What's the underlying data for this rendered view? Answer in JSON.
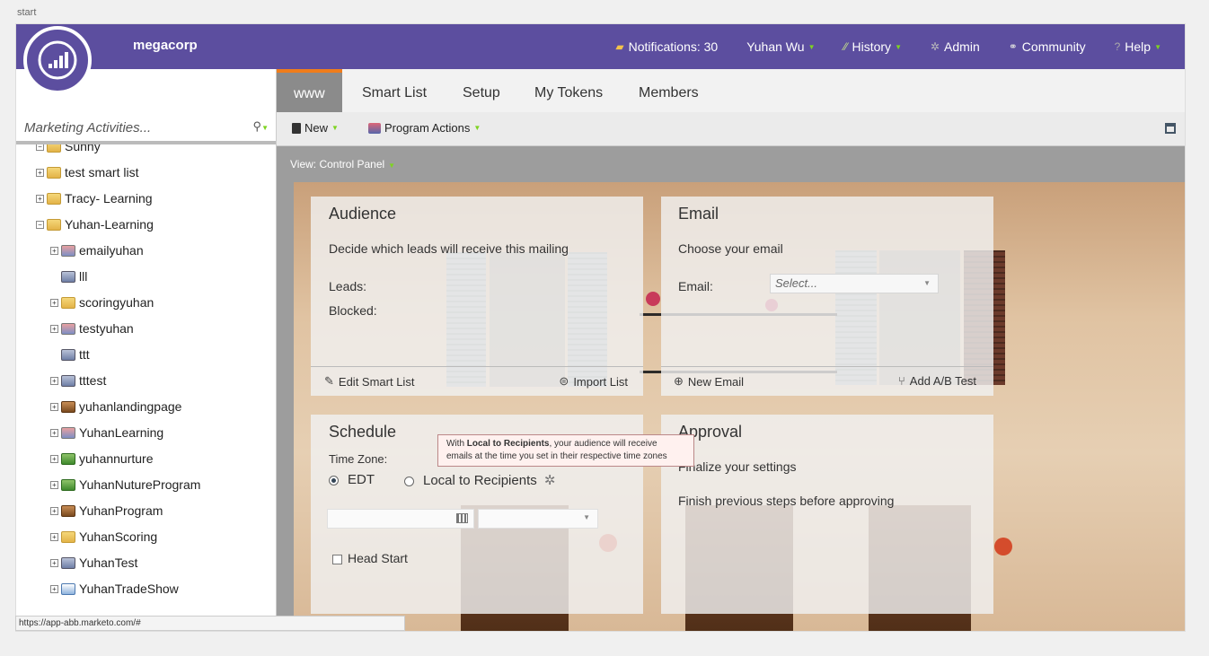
{
  "start_label": "start",
  "brand": "megacorp",
  "topnav": {
    "notifications": "Notifications: 30",
    "user": "Yuhan Wu",
    "history": "History",
    "admin": "Admin",
    "community": "Community",
    "help": "Help"
  },
  "sidebar": {
    "search_placeholder": "Marketing Activities...",
    "items": [
      {
        "label": "Sunny",
        "icon": "folder"
      },
      {
        "label": "test smart list",
        "icon": "folder"
      },
      {
        "label": "Tracy- Learning",
        "icon": "folder"
      },
      {
        "label": "Yuhan-Learning",
        "icon": "folder"
      },
      {
        "label": "emailyuhan",
        "icon": "program"
      },
      {
        "label": "lll",
        "icon": "email-program"
      },
      {
        "label": "scoringyuhan",
        "icon": "folder"
      },
      {
        "label": "testyuhan",
        "icon": "program"
      },
      {
        "label": "ttt",
        "icon": "email-program"
      },
      {
        "label": "tttest",
        "icon": "email-program"
      },
      {
        "label": "yuhanlandingpage",
        "icon": "landing"
      },
      {
        "label": "YuhanLearning",
        "icon": "program"
      },
      {
        "label": "yuhannurture",
        "icon": "nurture"
      },
      {
        "label": "YuhanNutureProgram",
        "icon": "nurture"
      },
      {
        "label": "YuhanProgram",
        "icon": "landing"
      },
      {
        "label": "YuhanScoring",
        "icon": "folder"
      },
      {
        "label": "YuhanTest",
        "icon": "email-program"
      },
      {
        "label": "YuhanTradeShow",
        "icon": "event"
      }
    ]
  },
  "status_url": "https://app-abb.marketo.com/#",
  "tabs": {
    "www": "www",
    "smart_list": "Smart List",
    "setup": "Setup",
    "my_tokens": "My Tokens",
    "members": "Members"
  },
  "toolbar": {
    "new": "New",
    "program_actions": "Program Actions"
  },
  "view_label": "View: Control Panel",
  "audience": {
    "title": "Audience",
    "desc": "Decide which leads will receive this mailing",
    "leads": "Leads:",
    "blocked": "Blocked:",
    "edit_smart_list": "Edit Smart List",
    "import_list": "Import List"
  },
  "email": {
    "title": "Email",
    "desc": "Choose your email",
    "field_label": "Email:",
    "select_placeholder": "Select...",
    "new_email": "New Email",
    "add_ab_test": "Add A/B Test"
  },
  "schedule": {
    "title": "Schedule",
    "time_zone": "Time Zone:",
    "edt": "EDT",
    "local": "Local to Recipients",
    "head_start": "Head Start"
  },
  "approval": {
    "title": "Approval",
    "desc": "Finalize your settings",
    "note": "Finish previous steps before approving"
  },
  "tooltip": {
    "prefix": "With ",
    "bold": "Local to Recipients",
    "suffix": ", your audience will receive emails at the time you set in their respective time zones"
  },
  "colors": {
    "header": "#5c4e9f",
    "accent": "#f07d1b",
    "caret": "#7ed321"
  }
}
